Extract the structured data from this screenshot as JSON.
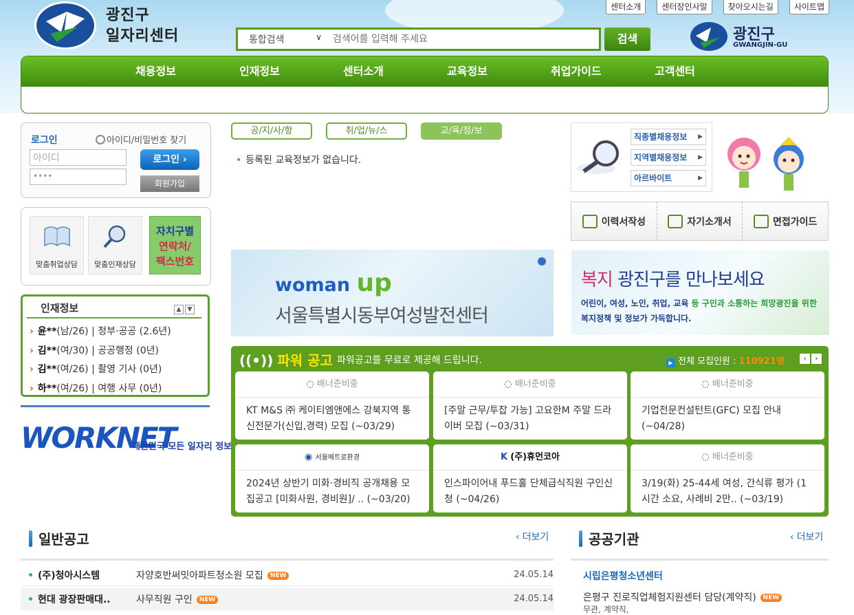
{
  "header": {
    "logo_text_line1": "광진구",
    "logo_text_line2": "일자리센터",
    "top_links": [
      "센터소개",
      "센터장인사말",
      "찾아오시는길",
      "사이트맵"
    ],
    "search_scope": "통합검색",
    "search_placeholder": "검색어를 입력해 주세요",
    "search_button": "검색",
    "district_logo_name": "광진구",
    "district_logo_sub": "GWANGJIN-GU"
  },
  "nav": [
    "채용정보",
    "인재정보",
    "센터소개",
    "교육정보",
    "취업가이드",
    "고객센터"
  ],
  "login": {
    "title": "로그인",
    "find": "아이디/비밀번호 찾기",
    "id_placeholder": "아이디",
    "pw_placeholder": "••••",
    "login_button": "로그인 ›",
    "join_button": "회원가입"
  },
  "quick": {
    "item1": "맞춤취업상담",
    "item2": "맞춤인재상담",
    "green_line1": "자치구별",
    "green_line2": "연락처/",
    "green_line3": "팩스번호"
  },
  "talent": {
    "title": "인재정보",
    "items": [
      {
        "name": "윤**",
        "info": "(남/26) | 정부·공공 (2.6년)"
      },
      {
        "name": "김**",
        "info": "(여/30) | 공공행정 (0년)"
      },
      {
        "name": "김**",
        "info": "(여/26) | 촬영 기사 (0년)"
      },
      {
        "name": "하**",
        "info": "(여/26) | 여행 사무 (0년)"
      }
    ]
  },
  "worknet": {
    "logo": "WORKNET",
    "desc": "대한민국 모든 일자리 정보"
  },
  "tabs": [
    "공/지/사/항",
    "취/업/뉴/스",
    "교/육/정/보"
  ],
  "edu_empty": "등록된 교육정보가 없습니다.",
  "banner_woman": {
    "woman": "woman",
    "up": "up",
    "name": "서울특별시동부여성발전센터"
  },
  "power": {
    "title": "파워 공고",
    "subtitle": "파워공고를 무료로 제공해 드립니다.",
    "total_label": "전체 모집인원 :",
    "total_value": "110921명",
    "cards": [
      {
        "logo": "배너준비중",
        "text": "KT M&S ㈜ 케이티엠앤에스 강북지역 통신전문가(신입,경력) 모집 (~03/29)"
      },
      {
        "logo": "배너준비중",
        "text": "[주말 근무/투잡 가능] 고요한M 주말 드라이버 모집 (~03/31)"
      },
      {
        "logo": "배너준비중",
        "text": "기업전문컨설턴트(GFC) 모집 안내 (~04/28)"
      },
      {
        "logo": "서울메트로환경",
        "text": "2024년 상반기 미화·경비직 공개채용 모집공고 [미화사원, 경비원]/ .. (~03/20)"
      },
      {
        "logo": "(주)휴먼코아",
        "text": "인스파이어내 푸드홀 단체급식직원 구인신청 (~04/26)"
      },
      {
        "logo": "배너준비중",
        "text": "3/19(화) 25-44세 여성, 간식류 평가 (1시간 소요, 사례비 2만.. (~03/19)"
      }
    ]
  },
  "right": {
    "links": [
      "직종별채용정보",
      "지역별채용정보",
      "아르바이트"
    ],
    "docs": [
      "이력서작성",
      "자기소개서",
      "면접가이드"
    ],
    "welfare_title_a": "복지",
    "welfare_title_b": " 광진구를 만나보세요",
    "welfare_line1_a": "어린이, 여성, 노인, 취업, 교육",
    "welfare_line1_b": " 등 구민과 소통하는 희망광진을 위한",
    "welfare_line2": "복지정책 및 정보가 가득합니다."
  },
  "notices": {
    "title": "일반공고",
    "more": "더보기",
    "rows": [
      {
        "org": "(주)청아시스템",
        "title": "자양호반써밋아파트청소원 모집",
        "date": "24.05.14"
      },
      {
        "org": "현대 광장판매대..",
        "title": "사무직원 구인",
        "date": "24.05.14"
      }
    ]
  },
  "public": {
    "title": "공공기관",
    "more": "더보기",
    "org": "시립은평청소년센터",
    "item": "은평구 진로직업체험지원센터 담당(계약직)",
    "sub": "무관, 계약직,"
  },
  "new_badge": "NEW"
}
